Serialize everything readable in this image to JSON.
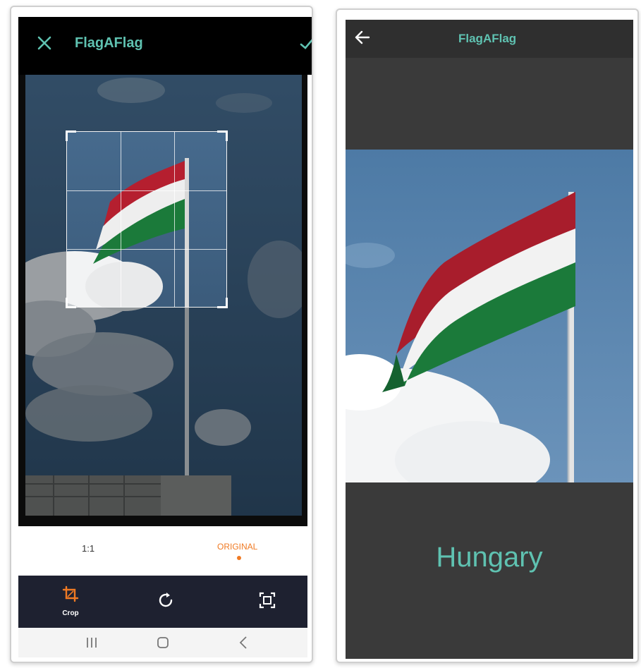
{
  "crop_screen": {
    "app_title": "FlagAFlag",
    "icons": {
      "close": "close-icon",
      "confirm": "check-icon",
      "crop": "crop-icon",
      "rotate": "rotate-icon",
      "fit": "fit-screen-icon"
    },
    "ratio_options": [
      {
        "label": "1:1",
        "selected": false
      },
      {
        "label": "ORIGINAL",
        "selected": true
      }
    ],
    "tools": {
      "crop_label": "Crop"
    },
    "colors": {
      "accent_teal": "#5fc2b1",
      "accent_orange": "#f07a23",
      "toolbar_bg": "#1e2130"
    }
  },
  "result_screen": {
    "app_title": "FlagAFlag",
    "icons": {
      "back": "arrow-back-icon"
    },
    "country_name": "Hungary",
    "colors": {
      "panel_bg": "#3a3a3a",
      "text_teal": "#5fc2b1"
    }
  },
  "system_nav": {
    "icons": [
      "recents-icon",
      "home-icon",
      "back-chevron-icon"
    ]
  }
}
